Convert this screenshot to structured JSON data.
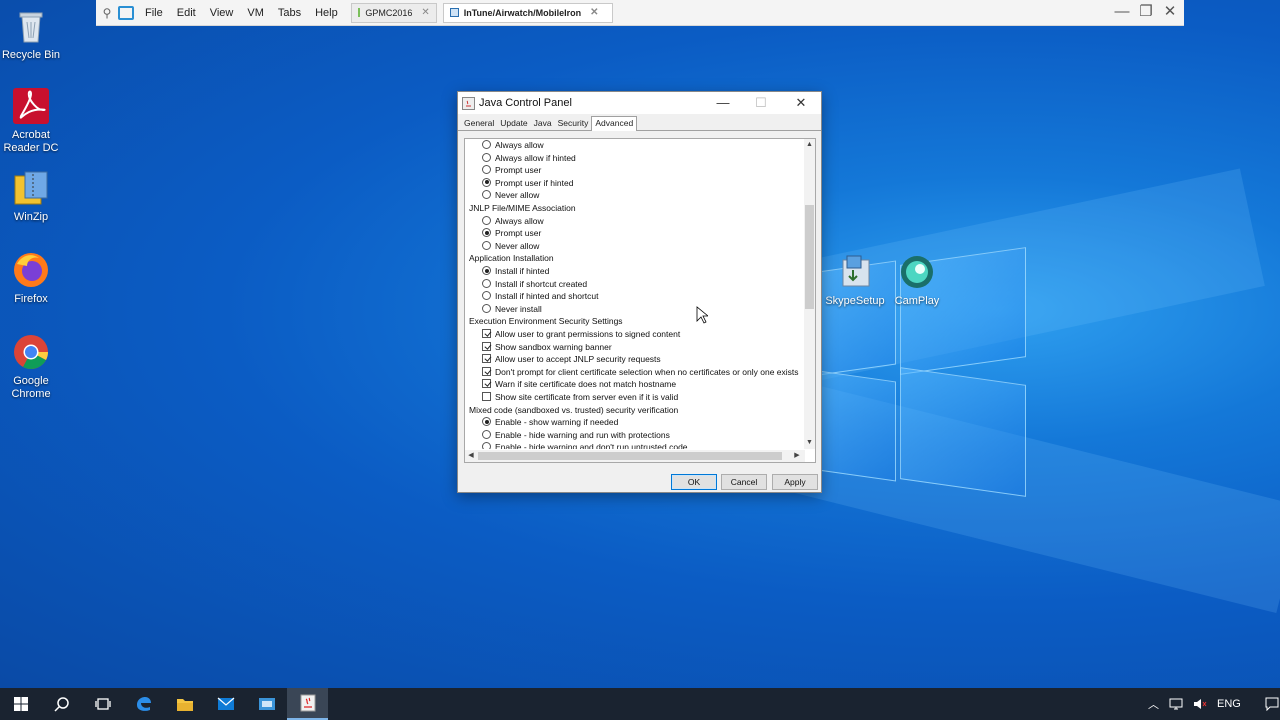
{
  "desktop": {
    "icons": [
      {
        "label": "Recycle Bin",
        "icon": "recycle-bin-icon"
      },
      {
        "label": "Acrobat Reader DC",
        "icon": "acrobat-icon"
      },
      {
        "label": "WinZip",
        "icon": "winzip-icon"
      },
      {
        "label": "Firefox",
        "icon": "firefox-icon"
      },
      {
        "label": "Google Chrome",
        "icon": "chrome-icon"
      },
      {
        "label": "SkypeSetup",
        "icon": "installer-icon"
      },
      {
        "label": "CamPlay",
        "icon": "camplay-icon"
      }
    ]
  },
  "vmbar": {
    "menus": [
      "File",
      "Edit",
      "View",
      "VM",
      "Tabs",
      "Help"
    ],
    "tabs": [
      {
        "label": "GPMC2016",
        "active": false
      },
      {
        "label": "InTune/Airwatch/MobileIron",
        "active": true
      }
    ]
  },
  "java_window": {
    "title": "Java Control Panel",
    "tabs": [
      "General",
      "Update",
      "Java",
      "Security",
      "Advanced"
    ],
    "selected_tab": "Advanced",
    "rows": [
      {
        "kind": "radio",
        "label": "Always allow",
        "checked": false
      },
      {
        "kind": "radio",
        "label": "Always allow if hinted",
        "checked": false
      },
      {
        "kind": "radio",
        "label": "Prompt user",
        "checked": false
      },
      {
        "kind": "radio",
        "label": "Prompt user if hinted",
        "checked": true
      },
      {
        "kind": "radio",
        "label": "Never allow",
        "checked": false
      },
      {
        "kind": "section",
        "label": "JNLP File/MIME Association"
      },
      {
        "kind": "radio",
        "label": "Always allow",
        "checked": false
      },
      {
        "kind": "radio",
        "label": "Prompt user",
        "checked": true
      },
      {
        "kind": "radio",
        "label": "Never allow",
        "checked": false
      },
      {
        "kind": "section",
        "label": "Application Installation"
      },
      {
        "kind": "radio",
        "label": "Install if hinted",
        "checked": true
      },
      {
        "kind": "radio",
        "label": "Install if shortcut created",
        "checked": false
      },
      {
        "kind": "radio",
        "label": "Install if hinted and shortcut",
        "checked": false
      },
      {
        "kind": "radio",
        "label": "Never install",
        "checked": false
      },
      {
        "kind": "section",
        "label": "Execution Environment Security Settings"
      },
      {
        "kind": "check",
        "label": "Allow user to grant permissions to signed content",
        "checked": true
      },
      {
        "kind": "check",
        "label": "Show sandbox warning banner",
        "checked": true
      },
      {
        "kind": "check",
        "label": "Allow user to accept JNLP security requests",
        "checked": true
      },
      {
        "kind": "check",
        "label": "Don't prompt for client certificate selection when no certificates or only one exists",
        "checked": true
      },
      {
        "kind": "check",
        "label": "Warn if site certificate does not match hostname",
        "checked": true
      },
      {
        "kind": "check",
        "label": "Show site certificate from server even if it is valid",
        "checked": false
      },
      {
        "kind": "section",
        "label": "Mixed code (sandboxed vs. trusted) security verification"
      },
      {
        "kind": "radio",
        "label": "Enable - show warning if needed",
        "checked": true
      },
      {
        "kind": "radio",
        "label": "Enable - hide warning and run with protections",
        "checked": false
      },
      {
        "kind": "radio",
        "label": "Enable - hide warning and don't run untrusted code",
        "checked": false
      }
    ],
    "buttons": {
      "ok": "OK",
      "cancel": "Cancel",
      "apply": "Apply"
    }
  },
  "taskbar": {
    "items": [
      "start-icon",
      "search-icon",
      "task-view-icon",
      "edge-icon",
      "file-explorer-icon",
      "mail-icon",
      "server-manager-icon",
      "java-icon"
    ],
    "language": "ENG"
  },
  "colors": {
    "accent": "#0078d7",
    "taskbar": "#1a2330",
    "desktop": "#0b5cc4"
  }
}
